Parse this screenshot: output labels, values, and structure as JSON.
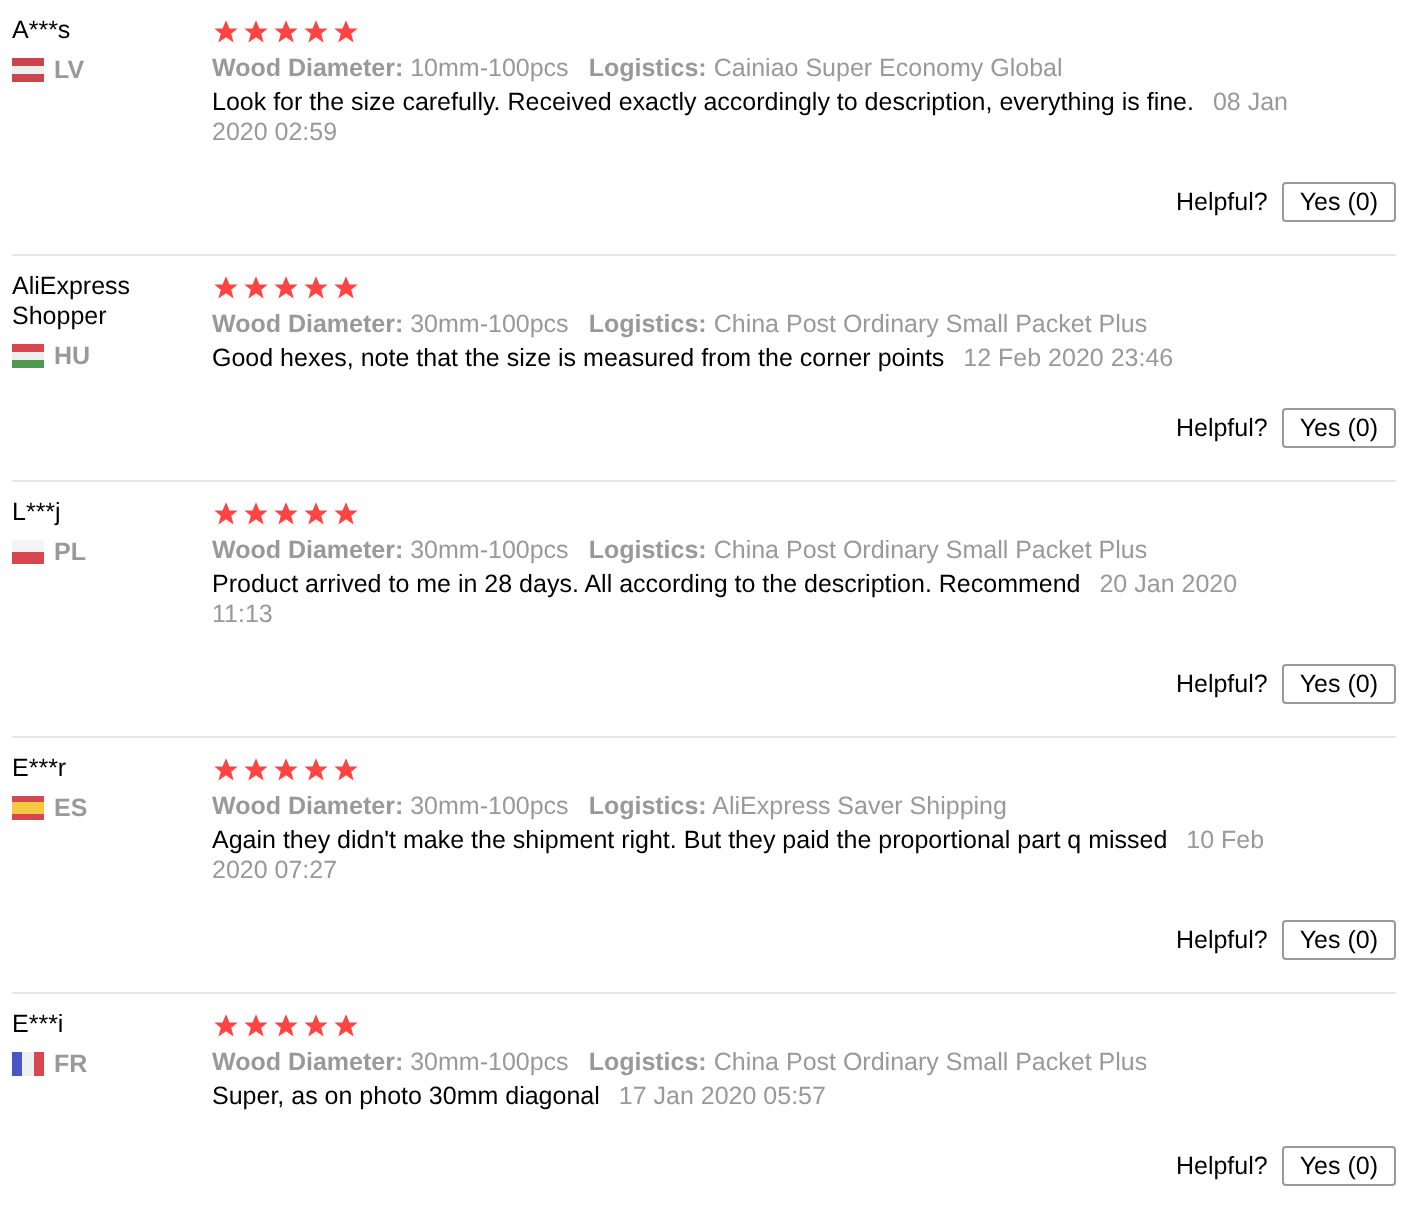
{
  "reviews": [
    {
      "name": "A***s",
      "country": "LV",
      "flag": {
        "kind": "horizontal",
        "stripes": [
          {
            "color": "#c8474f"
          },
          {
            "color": "#eeeeee"
          },
          {
            "color": "#c8474f"
          }
        ]
      },
      "stars": 5,
      "attributes": [
        {
          "label": "Wood Diameter:",
          "value": "10mm-100pcs"
        },
        {
          "label": "Logistics:",
          "value": "Cainiao Super Economy Global"
        }
      ],
      "comment": "Look for the size carefully. Received exactly accordingly to description, everything is fine.",
      "date": "08 Jan 2020 02:59",
      "helpful_label": "Helpful?",
      "yes_button": "Yes (0)"
    },
    {
      "name": "AliExpress Shopper",
      "country": "HU",
      "flag": {
        "kind": "horizontal",
        "stripes": [
          {
            "color": "#d8474f"
          },
          {
            "color": "#eeeeee"
          },
          {
            "color": "#4f9a4f"
          }
        ]
      },
      "stars": 5,
      "attributes": [
        {
          "label": "Wood Diameter:",
          "value": "30mm-100pcs"
        },
        {
          "label": "Logistics:",
          "value": "China Post Ordinary Small Packet Plus"
        }
      ],
      "comment": "Good hexes, note that the size is measured from the corner points",
      "date": "12 Feb 2020 23:46",
      "helpful_label": "Helpful?",
      "yes_button": "Yes (0)"
    },
    {
      "name": "L***j",
      "country": "PL",
      "flag": {
        "kind": "horizontal",
        "stripes": [
          {
            "color": "#f4f4f4"
          },
          {
            "color": "#d8474f"
          }
        ]
      },
      "stars": 5,
      "attributes": [
        {
          "label": "Wood Diameter:",
          "value": "30mm-100pcs"
        },
        {
          "label": "Logistics:",
          "value": "China Post Ordinary Small Packet Plus"
        }
      ],
      "comment": "Product arrived to me in 28 days. All according to the description. Recommend",
      "date": "20 Jan 2020 11:13",
      "helpful_label": "Helpful?",
      "yes_button": "Yes (0)"
    },
    {
      "name": "E***r",
      "country": "ES",
      "flag": {
        "kind": "horizontal",
        "stripes": [
          {
            "color": "#d8474f"
          },
          {
            "color": "#f5c842"
          },
          {
            "color": "#f5c842"
          },
          {
            "color": "#d8474f"
          }
        ]
      },
      "stars": 5,
      "attributes": [
        {
          "label": "Wood Diameter:",
          "value": "30mm-100pcs"
        },
        {
          "label": "Logistics:",
          "value": "AliExpress Saver Shipping"
        }
      ],
      "comment": "Again they didn't make the shipment right. But they paid the proportional part q missed",
      "date": "10 Feb 2020 07:27",
      "helpful_label": "Helpful?",
      "yes_button": "Yes (0)"
    },
    {
      "name": "E***i",
      "country": "FR",
      "flag": {
        "kind": "vertical",
        "stripes": [
          {
            "color": "#4a55c8"
          },
          {
            "color": "#eeeeee"
          },
          {
            "color": "#d8474f"
          }
        ]
      },
      "stars": 5,
      "attributes": [
        {
          "label": "Wood Diameter:",
          "value": "30mm-100pcs"
        },
        {
          "label": "Logistics:",
          "value": "China Post Ordinary Small Packet Plus"
        }
      ],
      "comment": "Super, as on photo 30mm diagonal",
      "date": "17 Jan 2020 05:57",
      "helpful_label": "Helpful?",
      "yes_button": "Yes (0)"
    }
  ]
}
